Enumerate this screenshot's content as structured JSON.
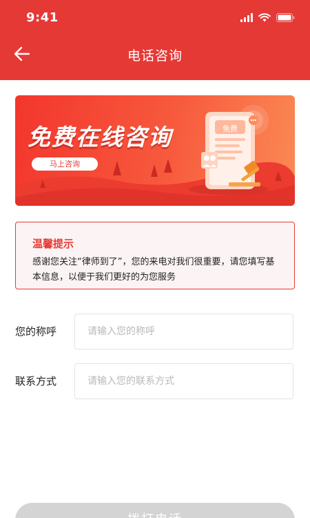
{
  "status_bar": {
    "time": "9:41"
  },
  "nav": {
    "title": "电话咨询",
    "back_icon": "arrow-left-icon"
  },
  "banner": {
    "title": "免费在线咨询",
    "button_label": "马上咨询",
    "phone_label": "免费"
  },
  "tip": {
    "title": "温馨提示",
    "text": "感谢您关注“律师到了”，您的来电对我们很重要，请您填写基本信息，以便于我们更好的为您服务"
  },
  "form": {
    "name_label": "您的称呼",
    "name_placeholder": "请输入您的称呼",
    "contact_label": "联系方式",
    "contact_placeholder": "请输入您的联系方式"
  },
  "submit_label": "拨打电话",
  "colors": {
    "brand": "#e53936",
    "button_disabled": "#d4d4d4"
  }
}
